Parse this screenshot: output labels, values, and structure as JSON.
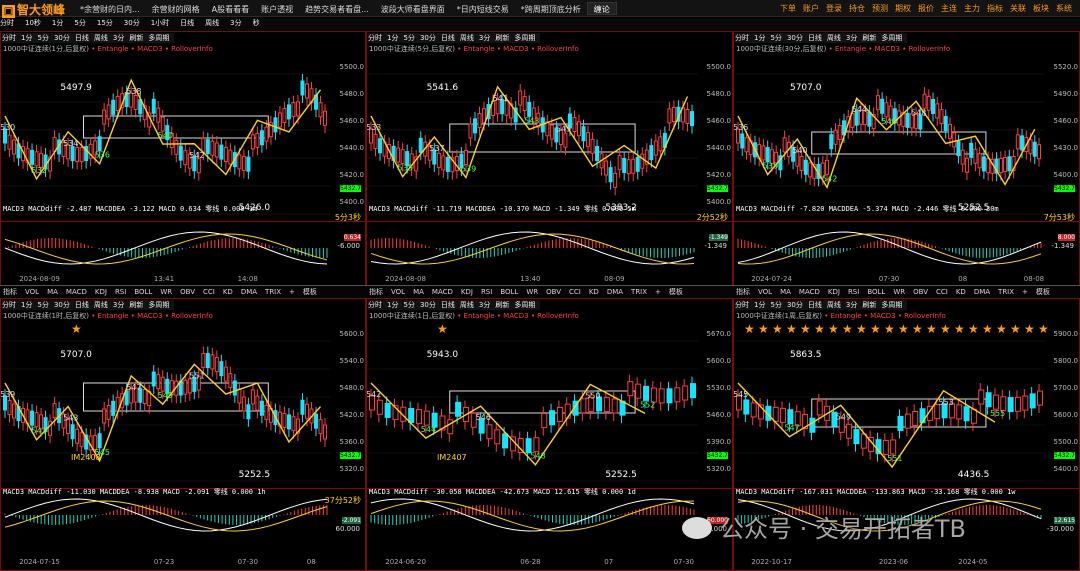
{
  "app": {
    "logo": "智大领峰",
    "tabs": [
      "*余营财的日内...",
      "余营财的网格",
      "A股看看看",
      "账户透视",
      "趋势交易者看盘...",
      "波段大师看盘界面",
      "*日内短线交易",
      "*跨周期顶底分析",
      "缠论"
    ],
    "right_menu": [
      "下单",
      "账户",
      "登录",
      "持仓",
      "预测",
      "期权",
      "报价",
      "主连",
      "主力",
      "指标",
      "关联",
      "板块",
      "系统"
    ]
  },
  "subbar": [
    "分时",
    "10秒",
    "1分",
    "5分",
    "15分",
    "30分",
    "1小时",
    "日线",
    "周线",
    "3分",
    "秒"
  ],
  "panel_toolbar": [
    "分时",
    "1分",
    "5分",
    "30分",
    "日线",
    "周线",
    "3分",
    "刷新",
    "多周期"
  ],
  "panels": [
    {
      "name": "1分",
      "title": "1000中证连续(1分,后复权)",
      "prices": [
        "5500.0",
        "5480.0",
        "5460.0",
        "5440.0",
        "5420.0",
        "5400.0"
      ],
      "labels": [
        "5497.9",
        "5426.0"
      ],
      "macd": "MACD3  MACDdiff -2.487  MACDDEA -3.122  MACD 0.634  零线 0.000  1m",
      "dates": [
        "2024-08-09",
        "13:41",
        "14:08"
      ],
      "timer": "5分3秒",
      "bottom_value": "0.634",
      "side_value": "5432.7",
      "neg": "-6.000"
    },
    {
      "name": "5分",
      "title": "1000中证连续(5分,后复权)",
      "prices": [
        "5500.0",
        "5480.0",
        "5460.0",
        "5440.0",
        "5420.0",
        "5400.0"
      ],
      "labels": [
        "5541.6",
        "5383.2"
      ],
      "macd": "MACD3  MACDdiff -11.719  MACDDEA -10.370  MACD -1.349  零线 0.000  5m",
      "dates": [
        "2024-08-08",
        "13:40",
        "08-09"
      ],
      "timer": "2分52秒",
      "bottom_value": "-1.349",
      "side_value": "5432.7",
      "neg": "-1.349"
    },
    {
      "name": "30分",
      "title": "1000中证连续(30分,后复权)",
      "prices": [
        "5520.0",
        "5490.0",
        "5460.0",
        "5430.0",
        "5400.0"
      ],
      "labels": [
        "5707.0",
        "5252.5"
      ],
      "macd": "MACD3  MACDdiff -7.820  MACDDEA -5.374  MACD -2.446  零线 0.000  30m",
      "dates": [
        "2024-07-24",
        "07-30",
        "08",
        "08-08"
      ],
      "timer": "7分53秒",
      "bottom_value": "8.000",
      "side_value": "5432.7",
      "neg": "-1.349"
    },
    {
      "name": "1时",
      "title": "1000中证连续(1时,后复权)",
      "prices": [
        "5600.0",
        "5540.0",
        "5480.0",
        "5420.0",
        "5360.0",
        "5320.0"
      ],
      "labels": [
        "5707.0",
        "5252.5"
      ],
      "macd": "MACD3  MACDdiff -11.030  MACDDEA -8.938  MACD -2.091  零线 0.000  1h",
      "dates": [
        "2024-07-15",
        "07-23",
        "07-30",
        "08"
      ],
      "timer": "37分52秒",
      "bottom_value": "-2.091",
      "side_value": "5432.7",
      "neg": "60.000"
    },
    {
      "name": "1日",
      "title": "1000中证连续(1日,后复权)",
      "prices": [
        "5670.0",
        "5600.0",
        "5530.0",
        "5460.0",
        "5390.0",
        "5320.0"
      ],
      "labels": [
        "5943.0",
        "5252.5"
      ],
      "macd": "MACD3  MACDdiff -30.058  MACDDEA -42.673  MACD 12.615  零线 0.000  1d",
      "dates": [
        "2024-06-20",
        "06-28",
        "07",
        "07-30"
      ],
      "timer": "",
      "bottom_value": "60.000",
      "side_value": "5432.7",
      "neg": "-30.000"
    },
    {
      "name": "1周",
      "title": "1000中证连续(1周,后复权)",
      "prices": [
        "5900.0",
        "5800.0",
        "5700.0",
        "5600.0",
        "5500.0",
        "5400.0"
      ],
      "labels": [
        "5863.5",
        "4436.5"
      ],
      "macd": "MACD3  MACDdiff -167.031  MACDDEA -133.863  MACD -33.168  零线 0.000  1w",
      "dates": [
        "2022-10-17",
        "2023-06",
        "2024-05"
      ],
      "timer": "",
      "bottom_value": "12.615",
      "side_value": "5432.7",
      "neg": "-30.000"
    }
  ],
  "mid_toolbar": [
    "指标",
    "VOL",
    "MA",
    "MACD",
    "KDJ",
    "RSI",
    "BOLL",
    "WR",
    "OBV",
    "CCI",
    "KD",
    "DMA",
    "TRIX",
    "+",
    "模板"
  ],
  "watermark": "公众号 · 交易开拓者TB"
}
